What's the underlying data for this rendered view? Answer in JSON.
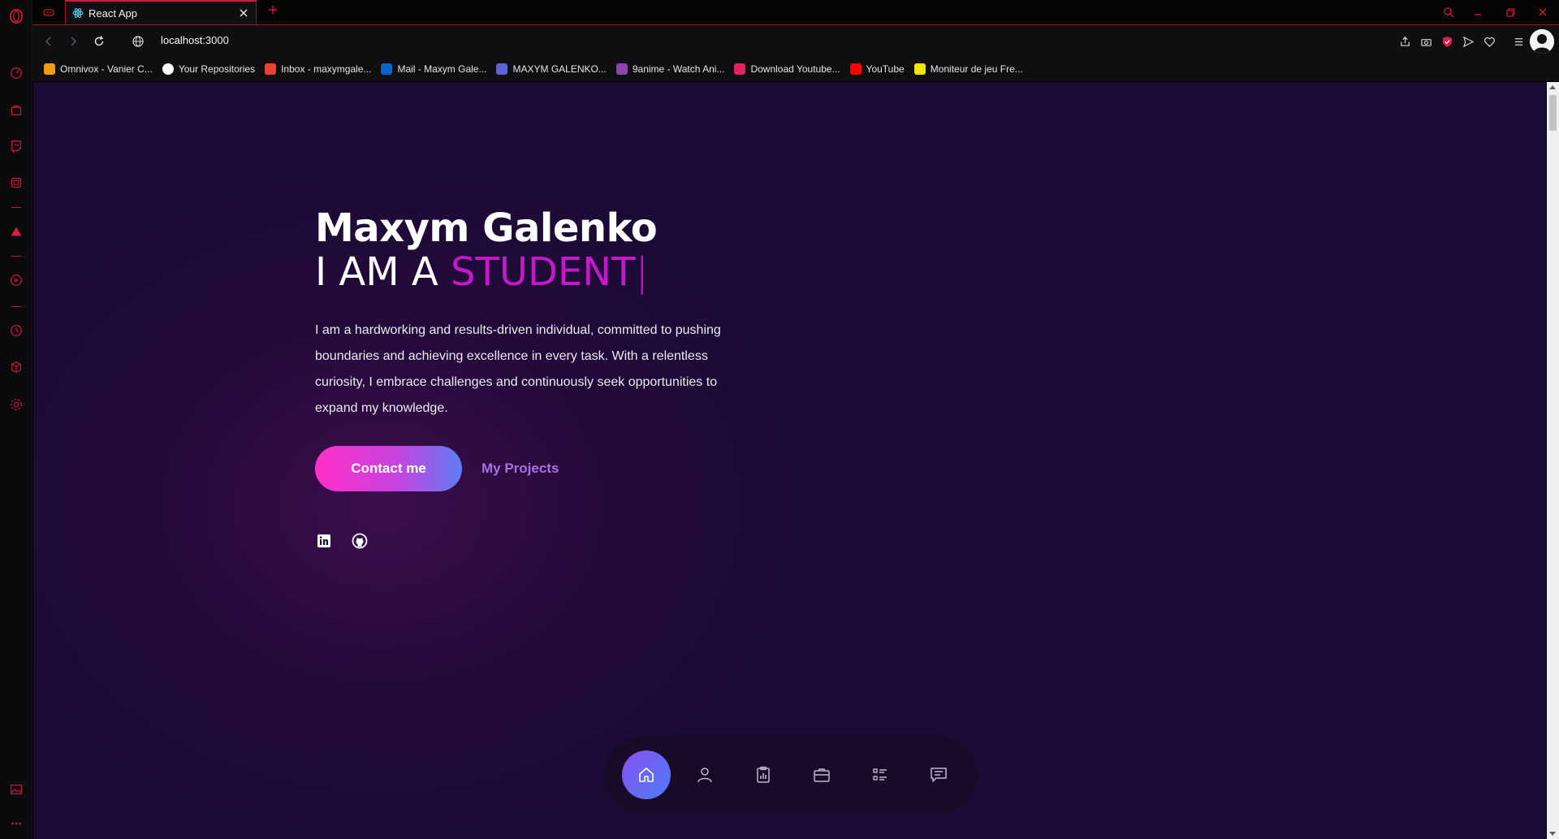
{
  "browser": {
    "tab_title": "React App",
    "url_host": "localhost",
    "url_port": ":3000",
    "accent_color": "#d0173c"
  },
  "bookmarks": [
    {
      "label": "Omnivox - Vanier C...",
      "color": "#f39c12"
    },
    {
      "label": "Your Repositories",
      "color": "#ffffff"
    },
    {
      "label": "Inbox - maxymgale...",
      "color": "#ea4335"
    },
    {
      "label": "Mail - Maxym Gale...",
      "color": "#0a64c8"
    },
    {
      "label": "MAXYM GALENKO...",
      "color": "#5b63d6"
    },
    {
      "label": "9anime - Watch Ani...",
      "color": "#8e44ad"
    },
    {
      "label": "Download Youtube...",
      "color": "#e0245e"
    },
    {
      "label": "YouTube",
      "color": "#ff0000"
    },
    {
      "label": "Moniteur de jeu Fre...",
      "color": "#f1e600"
    }
  ],
  "hero": {
    "name": "Maxym Galenko",
    "iam_prefix": "I AM A",
    "role": "STUDENT",
    "caret": "|",
    "description": "I am a hardworking and results-driven individual, committed to pushing boundaries and achieving excellence in every task. With a relentless curiosity, I embrace challenges and continuously seek opportunities to expand my knowledge.",
    "contact_label": "Contact me",
    "projects_label": "My Projects"
  },
  "socials": [
    "linkedin-icon",
    "github-icon"
  ],
  "dock": {
    "items": [
      "home-icon",
      "user-icon",
      "clipboard-chart-icon",
      "briefcase-icon",
      "list-icon",
      "chat-icon"
    ],
    "active": "home-icon"
  }
}
